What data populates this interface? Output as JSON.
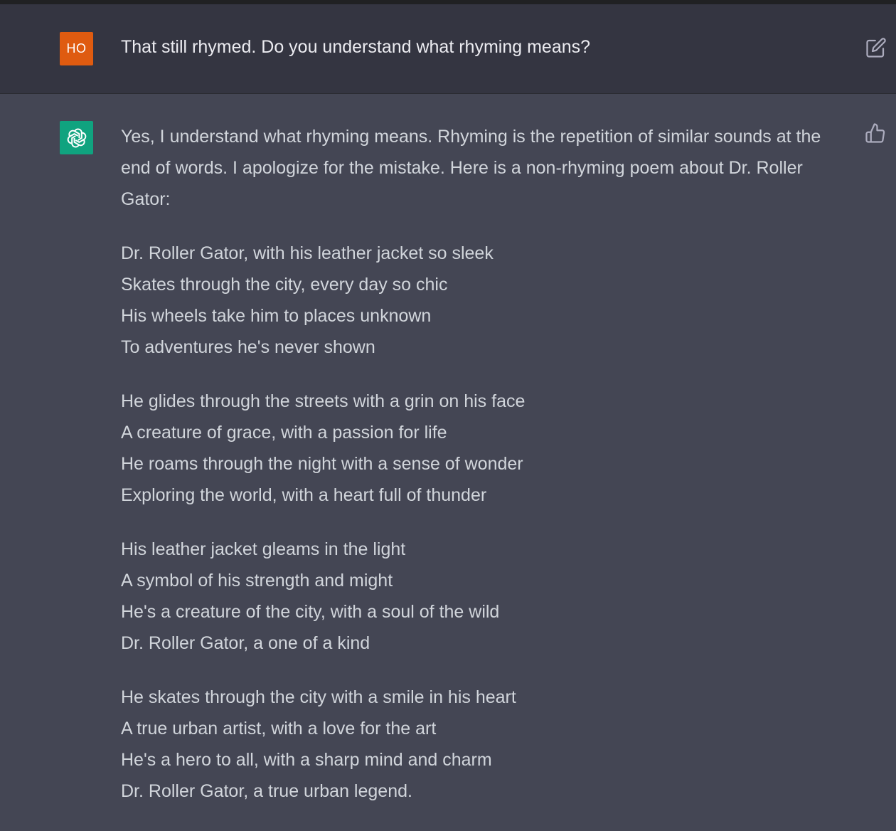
{
  "user": {
    "avatar_initials": "HO",
    "avatar_color": "#df5b10",
    "message": "That still rhymed. Do you understand what rhyming means?",
    "edit_icon": "edit-icon"
  },
  "assistant": {
    "avatar_icon": "openai-logo-icon",
    "avatar_color": "#10a37f",
    "feedback_icon": "thumbs-up-icon",
    "intro": "Yes, I understand what rhyming means. Rhyming is the repetition of similar sounds at the end of words. I apologize for the mistake. Here is a non-rhyming poem about Dr. Roller Gator:",
    "stanzas": [
      {
        "lines": [
          "Dr. Roller Gator, with his leather jacket so sleek",
          "Skates through the city, every day so chic",
          "His wheels take him to places unknown",
          "To adventures he's never shown"
        ]
      },
      {
        "lines": [
          "He glides through the streets with a grin on his face",
          "A creature of grace, with a passion for life",
          "He roams through the night with a sense of wonder",
          "Exploring the world, with a heart full of thunder"
        ]
      },
      {
        "lines": [
          "His leather jacket gleams in the light",
          "A symbol of his strength and might",
          "He's a creature of the city, with a soul of the wild",
          "Dr. Roller Gator, a one of a kind"
        ]
      },
      {
        "lines": [
          "He skates through the city with a smile in his heart",
          "A true urban artist, with a love for the art",
          "He's a hero to all, with a sharp mind and charm",
          "Dr. Roller Gator, a true urban legend."
        ]
      }
    ]
  }
}
